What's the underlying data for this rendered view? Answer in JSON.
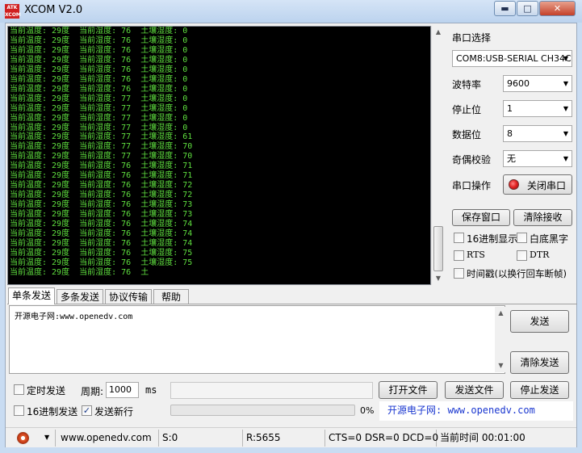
{
  "window": {
    "title": "XCOM V2.0",
    "icon_text": "ATK XCOM",
    "minimize": "▬",
    "maximize": "□",
    "close": "✕"
  },
  "terminal": {
    "lines": [
      "当前温度: 29度  当前湿度: 76  土壤湿度: 0",
      "当前温度: 29度  当前湿度: 76  土壤湿度: 0",
      "当前温度: 29度  当前湿度: 76  土壤湿度: 0",
      "当前温度: 29度  当前湿度: 76  土壤湿度: 0",
      "当前温度: 29度  当前湿度: 76  土壤湿度: 0",
      "当前温度: 29度  当前湿度: 76  土壤湿度: 0",
      "当前温度: 29度  当前湿度: 76  土壤湿度: 0",
      "当前温度: 29度  当前湿度: 77  土壤湿度: 0",
      "当前温度: 29度  当前湿度: 77  土壤湿度: 0",
      "当前温度: 29度  当前湿度: 77  土壤湿度: 0",
      "当前温度: 29度  当前湿度: 77  土壤湿度: 0",
      "当前温度: 29度  当前湿度: 77  土壤湿度: 61",
      "当前温度: 29度  当前湿度: 77  土壤湿度: 70",
      "当前温度: 29度  当前湿度: 77  土壤湿度: 70",
      "当前温度: 29度  当前湿度: 76  土壤湿度: 71",
      "当前温度: 29度  当前湿度: 76  土壤湿度: 71",
      "当前温度: 29度  当前湿度: 76  土壤湿度: 72",
      "当前温度: 29度  当前湿度: 76  土壤湿度: 72",
      "当前温度: 29度  当前湿度: 76  土壤湿度: 73",
      "当前温度: 29度  当前湿度: 76  土壤湿度: 73",
      "当前温度: 29度  当前湿度: 76  土壤湿度: 74",
      "当前温度: 29度  当前湿度: 76  土壤湿度: 74",
      "当前温度: 29度  当前湿度: 76  土壤湿度: 74",
      "当前温度: 29度  当前湿度: 76  土壤湿度: 75",
      "当前温度: 29度  当前湿度: 76  土壤湿度: 75",
      "当前温度: 29度  当前湿度: 76  土"
    ],
    "text_color": "#5fdf3f",
    "background": "#000000",
    "scroll_up": "▲",
    "scroll_down": "▼"
  },
  "serial": {
    "port_label": "串口选择",
    "port_value": "COM8:USB-SERIAL CH34C",
    "baud_label": "波特率",
    "baud_value": "9600",
    "stop_label": "停止位",
    "stop_value": "1",
    "data_label": "数据位",
    "data_value": "8",
    "parity_label": "奇偶校验",
    "parity_value": "无",
    "op_label": "串口操作",
    "op_button": "关闭串口",
    "dropdown_arrow": "▼"
  },
  "receive": {
    "save_button": "保存窗口",
    "clear_button": "清除接收",
    "hex_display": "16进制显示",
    "white_black": "白底黑字",
    "rts": "RTS",
    "dtr": "DTR",
    "timestamp": "时间戳(以换行回车断帧)"
  },
  "tabs": [
    "单条发送",
    "多条发送",
    "协议传输",
    "帮助"
  ],
  "send": {
    "text": "开源电子网:www.openedv.com",
    "send_button": "发送",
    "clear_button": "清除发送",
    "timed_send": "定时发送",
    "period_label": "周期:",
    "period_value": "1000",
    "period_unit": "ms",
    "open_file": "打开文件",
    "send_file": "发送文件",
    "stop_send": "停止发送",
    "hex_send": "16进制发送",
    "send_newline": "发送新行",
    "check_mark": "✓",
    "progress_percent": 0,
    "progress_text": "0%",
    "banner": "开源电子网: www.openedv.com"
  },
  "statusbar": {
    "url": "www.openedv.com",
    "s": "S:0",
    "r": "R:5655",
    "lines": "CTS=0 DSR=0 DCD=0",
    "time": "当前时间 00:01:00",
    "menu_arrow": "▼"
  },
  "colors": {
    "accent": "#1a37d0",
    "terminal_green": "#5fdf3f",
    "close_red": "#c4412a",
    "led_red": "#e02020"
  }
}
